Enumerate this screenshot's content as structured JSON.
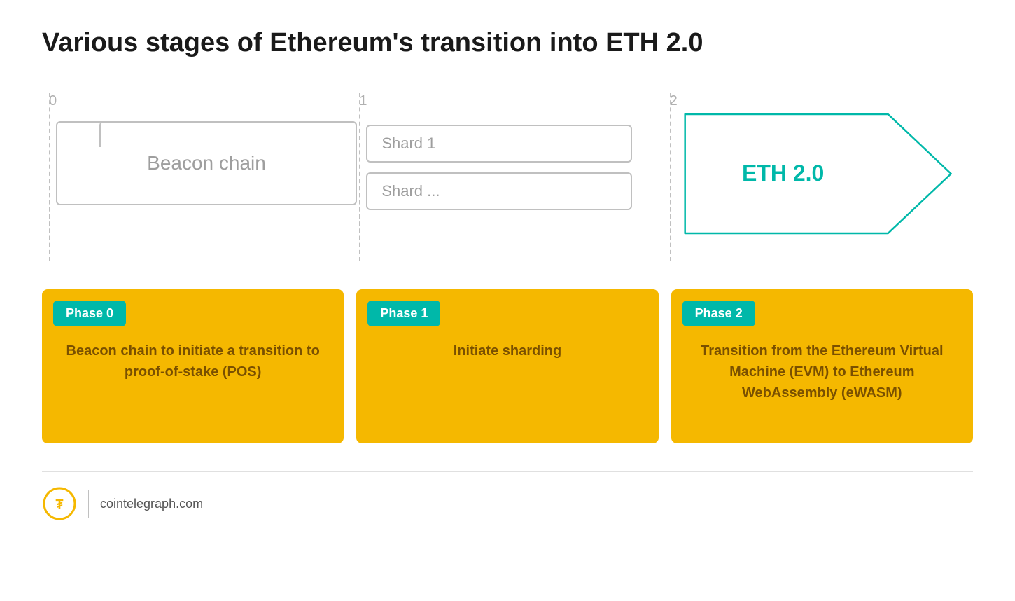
{
  "page": {
    "title": "Various stages of Ethereum's transition into ETH 2.0"
  },
  "diagram": {
    "phase0_number": "0",
    "phase1_number": "1",
    "phase2_number": "2",
    "beacon_chain_label": "Beacon chain",
    "shard1_label": "Shard 1",
    "shard_more_label": "Shard ...",
    "eth2_label": "ETH 2.0"
  },
  "cards": [
    {
      "badge": "Phase 0",
      "content": "Beacon chain to initiate a transition to proof-of-stake (POS)"
    },
    {
      "badge": "Phase 1",
      "content": "Initiate sharding"
    },
    {
      "badge": "Phase 2",
      "content": "Transition from the Ethereum Virtual Machine (EVM) to Ethereum WebAssembly (eWASM)"
    }
  ],
  "footer": {
    "url": "cointelegraph.com"
  },
  "colors": {
    "teal": "#00B8A9",
    "yellow": "#F5B800",
    "gray": "#9e9e9e"
  }
}
